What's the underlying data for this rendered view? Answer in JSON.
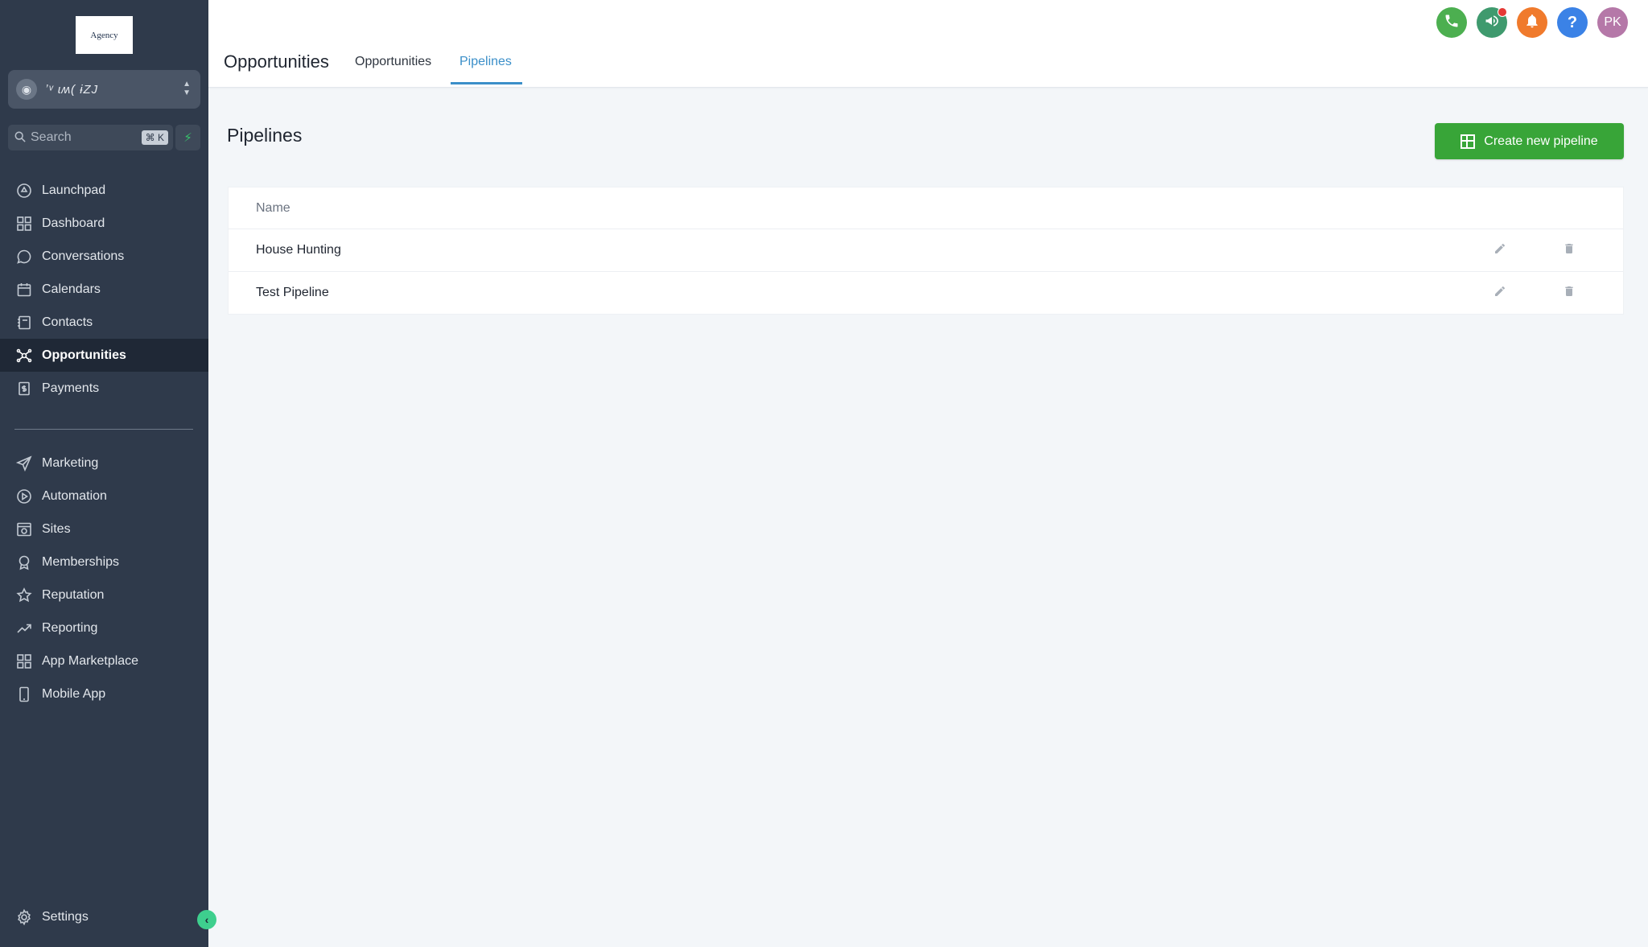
{
  "sidebar": {
    "logo_text": "Agency",
    "account_name": "ʼᵛ ɩʍ( ɨZJ",
    "search_placeholder": "Search",
    "search_shortcut": "⌘ K",
    "nav_top": [
      {
        "label": "Launchpad",
        "icon": "rocket-icon"
      },
      {
        "label": "Dashboard",
        "icon": "dashboard-icon"
      },
      {
        "label": "Conversations",
        "icon": "chat-icon"
      },
      {
        "label": "Calendars",
        "icon": "calendar-icon"
      },
      {
        "label": "Contacts",
        "icon": "contacts-icon"
      },
      {
        "label": "Opportunities",
        "icon": "opportunities-icon",
        "active": true
      },
      {
        "label": "Payments",
        "icon": "payments-icon"
      }
    ],
    "nav_bottom": [
      {
        "label": "Marketing",
        "icon": "send-icon"
      },
      {
        "label": "Automation",
        "icon": "automation-icon"
      },
      {
        "label": "Sites",
        "icon": "sites-icon"
      },
      {
        "label": "Memberships",
        "icon": "badge-icon"
      },
      {
        "label": "Reputation",
        "icon": "star-icon"
      },
      {
        "label": "Reporting",
        "icon": "trend-icon"
      },
      {
        "label": "App Marketplace",
        "icon": "apps-icon"
      },
      {
        "label": "Mobile App",
        "icon": "mobile-icon"
      }
    ],
    "settings_label": "Settings"
  },
  "header": {
    "title": "Opportunities",
    "tabs": [
      {
        "label": "Opportunities",
        "active": false
      },
      {
        "label": "Pipelines",
        "active": true
      }
    ],
    "avatar_initials": "PK",
    "icon_colors": {
      "phone": "#4caf50",
      "announcements": "#3f9a6e",
      "notifications": "#f07a2c",
      "help": "#3b82e6",
      "avatar": "#b578a8"
    }
  },
  "main": {
    "section_title": "Pipelines",
    "create_button_label": "Create new pipeline",
    "table": {
      "column_name": "Name",
      "rows": [
        {
          "name": "House Hunting"
        },
        {
          "name": "Test Pipeline"
        }
      ]
    }
  },
  "colors": {
    "sidebar_bg": "#2f3a4b",
    "accent_blue": "#3b8fc9",
    "primary_green": "#38a538"
  }
}
